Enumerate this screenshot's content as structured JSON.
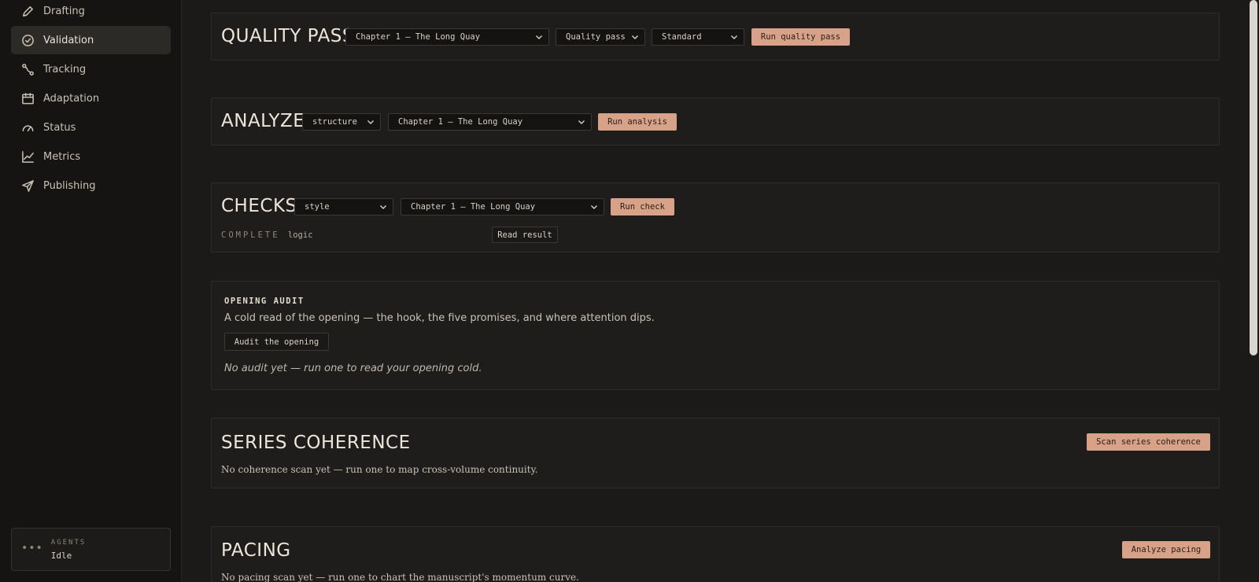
{
  "sidebar": {
    "items": [
      {
        "label": "Drafting",
        "icon": "pencil-icon"
      },
      {
        "label": "Validation",
        "icon": "check-circle-icon",
        "active": true
      },
      {
        "label": "Tracking",
        "icon": "route-icon"
      },
      {
        "label": "Adaptation",
        "icon": "calendar-icon"
      },
      {
        "label": "Status",
        "icon": "gauge-icon"
      },
      {
        "label": "Metrics",
        "icon": "line-chart-icon"
      },
      {
        "label": "Publishing",
        "icon": "send-icon"
      }
    ],
    "agents": {
      "label": "AGENTS",
      "value": "Idle"
    }
  },
  "quality_pass": {
    "title": "QUALITY PASS",
    "chapter_select": "Chapter 1 — The Long Quay",
    "mode_select": "Quality pass",
    "level_select": "Standard",
    "run_button": "Run quality pass"
  },
  "analyze": {
    "title": "ANALYZE",
    "type_select": "structure",
    "chapter_select": "Chapter 1 — The Long Quay",
    "run_button": "Run analysis"
  },
  "checks": {
    "title": "CHECKS",
    "type_select": "style",
    "chapter_select": "Chapter 1 — The Long Quay",
    "run_button": "Run check",
    "result_status": "COMPLETE",
    "result_name": "logic",
    "read_button": "Read result"
  },
  "opening_audit": {
    "title": "OPENING AUDIT",
    "description": "A cold read of the opening — the hook, the five promises, and where attention dips.",
    "audit_button": "Audit the opening",
    "empty_text": "No audit yet — run one to read your opening cold."
  },
  "series_coherence": {
    "title": "SERIES COHERENCE",
    "scan_button": "Scan series coherence",
    "empty_text": "No coherence scan yet — run one to map cross-volume continuity."
  },
  "pacing": {
    "title": "PACING",
    "analyze_button": "Analyze pacing",
    "empty_text": "No pacing scan yet — run one to chart the manuscript's momentum curve."
  },
  "colors": {
    "accent": "#d7a288",
    "background": "#1b1a18",
    "sidebar": "#151412",
    "panel": "#1e1d1b"
  }
}
